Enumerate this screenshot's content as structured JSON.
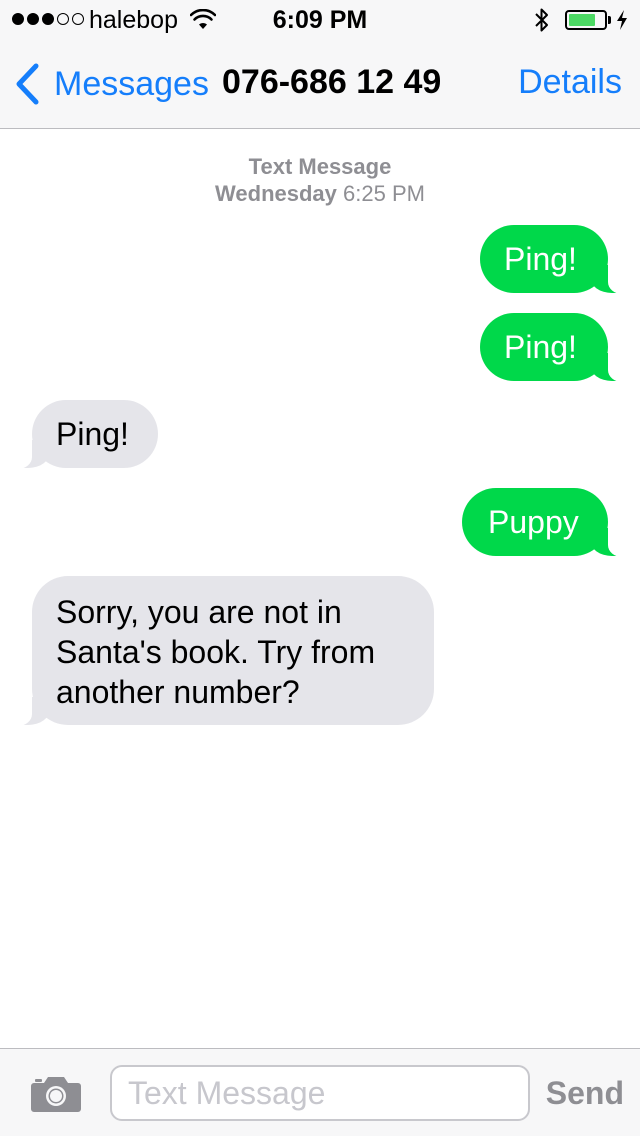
{
  "status_bar": {
    "carrier": "halebop",
    "time": "6:09 PM",
    "signal_strength_dots": 3,
    "signal_total_dots": 5,
    "battery_level": 0.75,
    "wifi_icon": "wifi-icon",
    "bluetooth_icon": "bluetooth-icon",
    "charging_icon": "bolt-icon"
  },
  "nav": {
    "back_label": "Messages",
    "title": "076-686 12 49",
    "details_label": "Details"
  },
  "conversation": {
    "timestamp": {
      "type": "Text Message",
      "day": "Wednesday",
      "time": "6:25 PM"
    },
    "messages": [
      {
        "direction": "sent",
        "text": "Ping!"
      },
      {
        "direction": "sent",
        "text": "Ping!"
      },
      {
        "direction": "received",
        "text": "Ping!"
      },
      {
        "direction": "sent",
        "text": "Puppy"
      },
      {
        "direction": "received",
        "text": "Sorry, you are not in Santa's book. Try from another number?"
      }
    ]
  },
  "input_bar": {
    "placeholder": "Text Message",
    "value": "",
    "send_label": "Send",
    "camera_icon": "camera-icon"
  },
  "colors": {
    "accent": "#157efb",
    "sent_bubble": "#00d84a",
    "received_bubble": "#e5e5ea",
    "meta_text": "#8e8e93",
    "battery_fill": "#4cd964"
  }
}
